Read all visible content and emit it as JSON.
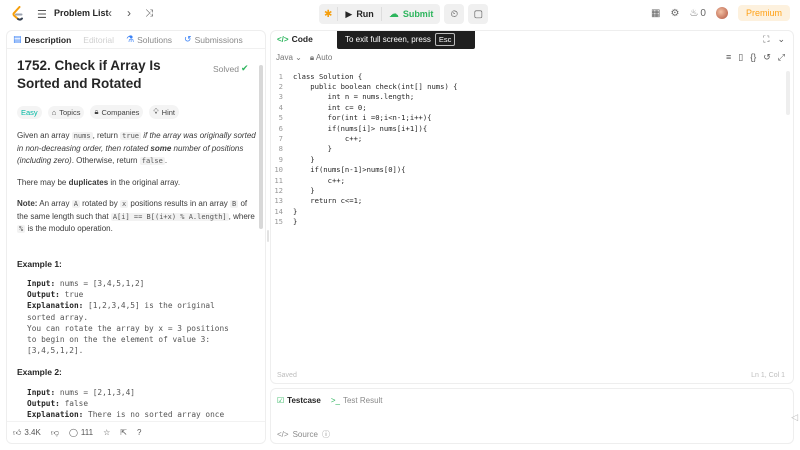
{
  "topbar": {
    "problem_list": "Problem List",
    "run": "Run",
    "submit": "Submit",
    "fire_count": "0",
    "premium": "Premium"
  },
  "left_tabs": [
    {
      "label": "Description",
      "state": "active"
    },
    {
      "label": "Editorial",
      "state": "disabled"
    },
    {
      "label": "Solutions",
      "state": "normal"
    },
    {
      "label": "Submissions",
      "state": "normal"
    }
  ],
  "problem": {
    "title": "1752. Check if Array Is Sorted and Rotated",
    "status": "Solved",
    "difficulty": "Easy",
    "topics": "Topics",
    "companies": "Companies",
    "hint": "Hint"
  },
  "description": {
    "p1_a": "Given an array ",
    "p1_code1": "nums",
    "p1_b": ", return ",
    "p1_code2": "true",
    "p1_c": " if the array was originally sorted in non-decreasing order, then rotated ",
    "p1_bold": "some",
    "p1_d": " number of positions (including zero)",
    "p1_e": ". Otherwise, return ",
    "p1_code3": "false",
    "p1_f": ".",
    "p2_a": "There may be ",
    "p2_bold": "duplicates",
    "p2_b": " in the original array.",
    "p3_bold": "Note:",
    "p3_a": " An array ",
    "p3_code1": "A",
    "p3_b": " rotated by ",
    "p3_code2": "x",
    "p3_c": " positions results in an array ",
    "p3_code3": "B",
    "p3_d": " of the same length such that ",
    "p3_code4": "A[i] == B[(i+x) % A.length]",
    "p3_e": ", where ",
    "p3_code5": "%",
    "p3_f": " is the modulo operation."
  },
  "examples": [
    {
      "heading": "Example 1:",
      "input_label": "Input:",
      "input": "nums = [3,4,5,1,2]",
      "output_label": "Output:",
      "output": "true",
      "explanation_label": "Explanation:",
      "explanation_lines": [
        "[1,2,3,4,5] is the original",
        "sorted array.",
        "You can rotate the array by x = 3 positions",
        "to begin on the the element of value 3:",
        "[3,4,5,1,2]."
      ]
    },
    {
      "heading": "Example 2:",
      "input_label": "Input:",
      "input": "nums = [2,1,3,4]",
      "output_label": "Output:",
      "output": "false",
      "explanation_label": "Explanation:",
      "explanation_lines": [
        "There is no sorted array once"
      ]
    }
  ],
  "left_bottom": {
    "likes": "3.4K",
    "comments": "111"
  },
  "code_tabs": {
    "code": "Code",
    "fullscreen_tip": "To exit full screen, press",
    "esc": "Esc"
  },
  "editor_toolbar": {
    "language": "Java",
    "mode": "Auto"
  },
  "code_lines": [
    {
      "n": "1",
      "text": "class Solution {"
    },
    {
      "n": "2",
      "text": "    public boolean check(int[] nums) {"
    },
    {
      "n": "3",
      "text": "        int n = nums.length;"
    },
    {
      "n": "4",
      "text": "        int c= 0;"
    },
    {
      "n": "5",
      "text": "        for(int i =0;i<n-1;i++){"
    },
    {
      "n": "6",
      "text": "        if(nums[i]> nums[i+1]){"
    },
    {
      "n": "7",
      "text": "            c++;"
    },
    {
      "n": "8",
      "text": "        }"
    },
    {
      "n": "9",
      "text": "    }"
    },
    {
      "n": "10",
      "text": "    if(nums[n-1]>nums[0]){"
    },
    {
      "n": "11",
      "text": "        c++;"
    },
    {
      "n": "12",
      "text": "    }"
    },
    {
      "n": "13",
      "text": "    return c<=1;"
    },
    {
      "n": "14",
      "text": "}"
    },
    {
      "n": "15",
      "text": "}"
    }
  ],
  "editor_status": {
    "saved": "Saved",
    "position": "Ln 1, Col 1"
  },
  "bottom_tabs": {
    "testcase": "Testcase",
    "test_result": "Test Result",
    "source": "Source"
  }
}
